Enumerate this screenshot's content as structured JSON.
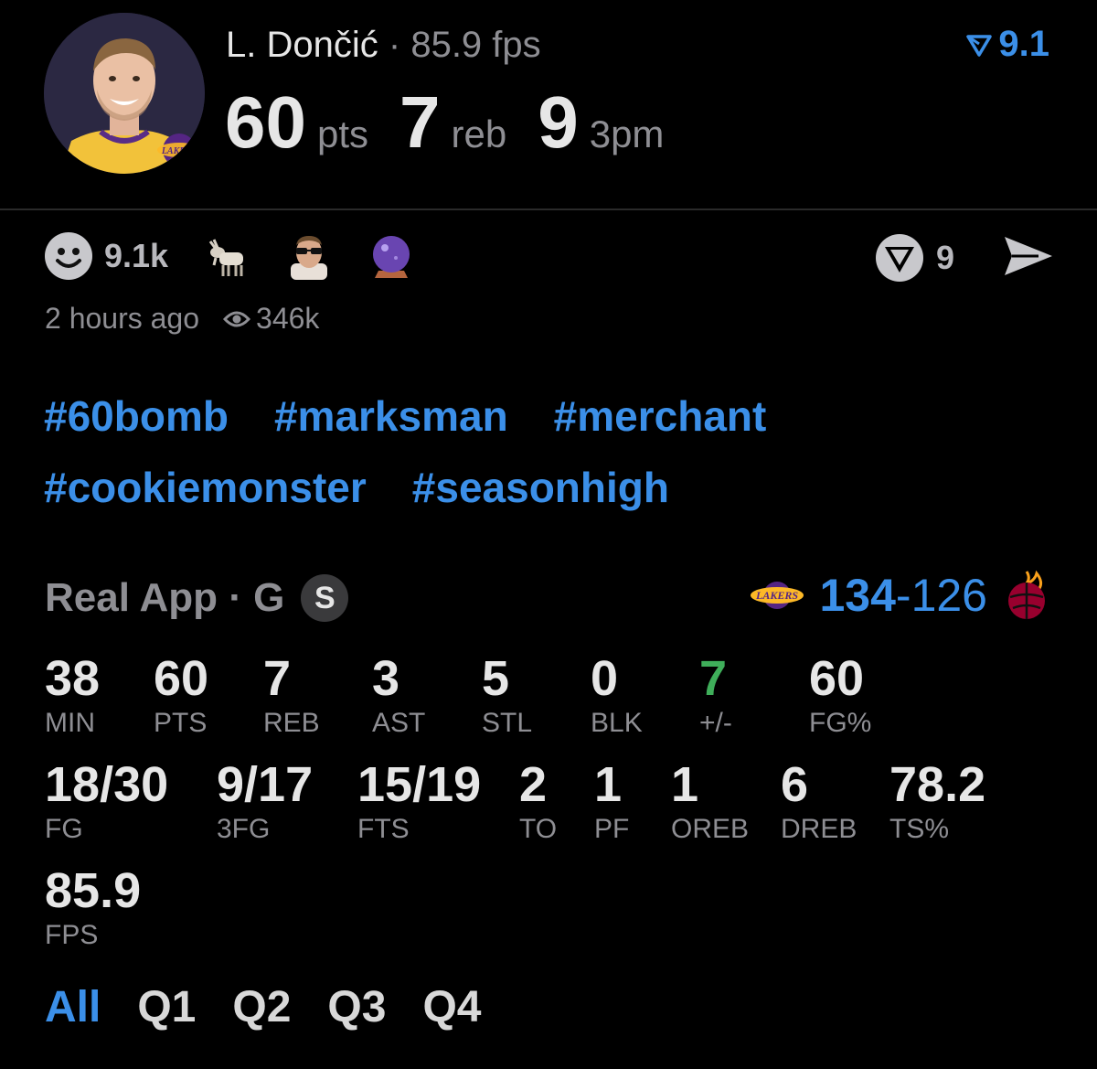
{
  "header": {
    "player_name": "L. Dončić",
    "separator": "·",
    "fps_text": "85.9 fps",
    "rating": "9.1",
    "stats": [
      {
        "value": "60",
        "unit": "pts"
      },
      {
        "value": "7",
        "unit": "reb"
      },
      {
        "value": "9",
        "unit": "3pm"
      }
    ]
  },
  "reactions": {
    "smile_count": "9.1k",
    "emojis": [
      "goat-emoji",
      "sunglasses-face-emoji",
      "crystal-ball-emoji"
    ],
    "vote_count": "9",
    "time_ago": "2 hours ago",
    "views": "346k"
  },
  "hashtags": [
    [
      "#60bomb",
      "#marksman",
      "#merchant"
    ],
    [
      "#cookiemonster",
      "#seasonhigh"
    ]
  ],
  "game": {
    "app_label": "Real App · G",
    "badge": "S",
    "home_score": "134",
    "dash": "-",
    "away_score": "126"
  },
  "box": {
    "row1": [
      {
        "value": "38",
        "label": "MIN"
      },
      {
        "value": "60",
        "label": "PTS"
      },
      {
        "value": "7",
        "label": "REB"
      },
      {
        "value": "3",
        "label": "AST"
      },
      {
        "value": "5",
        "label": "STL"
      },
      {
        "value": "0",
        "label": "BLK"
      },
      {
        "value": "7",
        "label": "+/-"
      },
      {
        "value": "60",
        "label": "FG%"
      }
    ],
    "row2": [
      {
        "value": "18/30",
        "label": "FG"
      },
      {
        "value": "9/17",
        "label": "3FG"
      },
      {
        "value": "15/19",
        "label": "FTS"
      },
      {
        "value": "2",
        "label": "TO"
      },
      {
        "value": "1",
        "label": "PF"
      },
      {
        "value": "1",
        "label": "OREB"
      },
      {
        "value": "6",
        "label": "DREB"
      },
      {
        "value": "78.2",
        "label": "TS%"
      }
    ],
    "row3": [
      {
        "value": "85.9",
        "label": "FPS"
      }
    ]
  },
  "tabs": [
    "All",
    "Q1",
    "Q2",
    "Q3",
    "Q4"
  ],
  "colors": {
    "accent": "#3b8fe8",
    "positive": "#3fae5a",
    "muted": "#8e8e93",
    "lakers_purple": "#552583",
    "lakers_gold": "#FDB927",
    "heat_red": "#98002E"
  }
}
